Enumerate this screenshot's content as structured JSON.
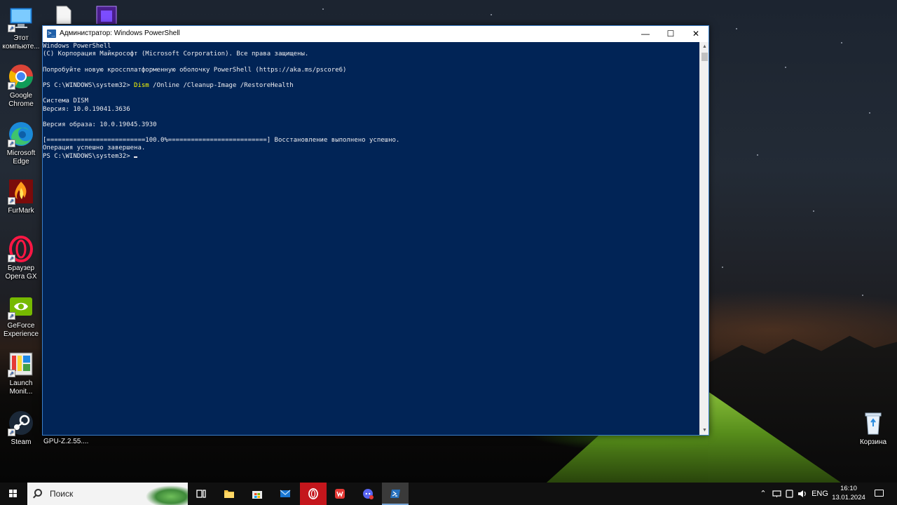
{
  "desktop": {
    "icons": [
      {
        "label": "Этот компьюте...",
        "icon": "this-pc-icon"
      },
      {
        "label": "Google Chrome",
        "icon": "chrome-icon"
      },
      {
        "label": "Microsoft Edge",
        "icon": "edge-icon"
      },
      {
        "label": "FurMark",
        "icon": "furmark-icon"
      },
      {
        "label": "Браузер Opera GX",
        "icon": "opera-gx-icon"
      },
      {
        "label": "GeForce Experience",
        "icon": "geforce-icon"
      },
      {
        "label": "Launch Monit...",
        "icon": "launch-monitor-icon"
      },
      {
        "label": "Steam",
        "icon": "steam-icon"
      },
      {
        "label": "GPU-Z.2.55....",
        "icon": "gpuz-icon"
      },
      {
        "label": "Корзина",
        "icon": "recycle-bin-icon"
      }
    ]
  },
  "window": {
    "title": "Администратор: Windows PowerShell",
    "minimize": "—",
    "maximize": "☐",
    "close": "✕",
    "console_lines": [
      "Windows PowerShell",
      "(C) Корпорация Майкрософт (Microsoft Corporation). Все права защищены.",
      "",
      "Попробуйте новую кроссплатформенную оболочку PowerShell (https://aka.ms/pscore6)",
      "",
      "",
      "",
      "Система DISM",
      "Версия: 10.0.19041.3636",
      "",
      "Версия образа: 10.0.19045.3930",
      "",
      "[==========================100.0%==========================] Восстановление выполнено успешно.",
      "Операция успешно завершена."
    ],
    "prompt": "PS C:\\WINDOWS\\system32> ",
    "command_name": "Dism",
    "command_args": " /Online /Cleanup-Image /RestoreHealth",
    "console_bg": "#012456",
    "console_fg": "#eeedf0",
    "command_color": "#ffff00"
  },
  "taskbar": {
    "search_placeholder": "Поиск",
    "language": "ENG",
    "time": "16:10",
    "date": "13.01.2024",
    "apps": [
      "task-view-icon",
      "file-explorer-icon",
      "store-icon",
      "mail-icon",
      "opera-gx-icon",
      "wps-office-icon",
      "discord-icon",
      "powershell-icon"
    ]
  }
}
